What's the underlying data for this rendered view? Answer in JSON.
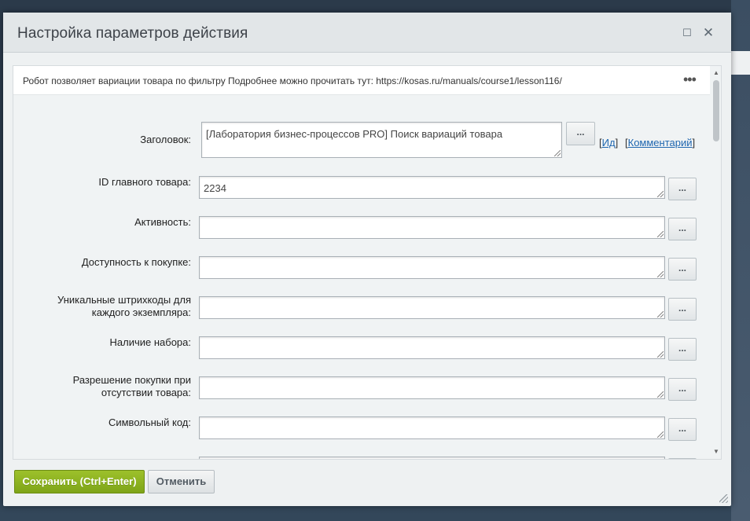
{
  "dialog": {
    "title": "Настройка параметров действия",
    "maximize_icon": "maximize-icon",
    "close_icon": "close-icon"
  },
  "description": {
    "text": "Робот позволяет вариации товара по фильтру Подробнее можно прочитать тут: https://kosas.ru/manuals/course1/lesson116/",
    "more_icon": "more-horizontal-icon"
  },
  "form": {
    "title_label": "Заголовок:",
    "title_value": "[Лаборатория бизнес-процессов PRO] Поиск вариаций товара",
    "title_dots": "...",
    "id_link_open": "[",
    "id_link": "Ид",
    "id_link_close": "]",
    "comment_link_open": "[",
    "comment_link": "Комментарий",
    "comment_link_close": "]",
    "fields": [
      {
        "label": "ID главного товара:",
        "value": "2234",
        "dots": "..."
      },
      {
        "label": "Активность:",
        "value": "",
        "dots": "..."
      },
      {
        "label": "Доступность к покупке:",
        "value": "",
        "dots": "..."
      },
      {
        "label": "Уникальные штрихкоды для каждого экземпляра:",
        "value": "",
        "dots": "..."
      },
      {
        "label": "Наличие набора:",
        "value": "",
        "dots": "..."
      },
      {
        "label": "Разрешение покупки при отсутствии товара:",
        "value": "",
        "dots": "..."
      },
      {
        "label": "Символьный код:",
        "value": "",
        "dots": "..."
      }
    ]
  },
  "footer": {
    "save_label": "Сохранить (Ctrl+Enter)",
    "cancel_label": "Отменить"
  },
  "colors": {
    "save_green": "#8bb022",
    "link_blue": "#2067b0"
  }
}
